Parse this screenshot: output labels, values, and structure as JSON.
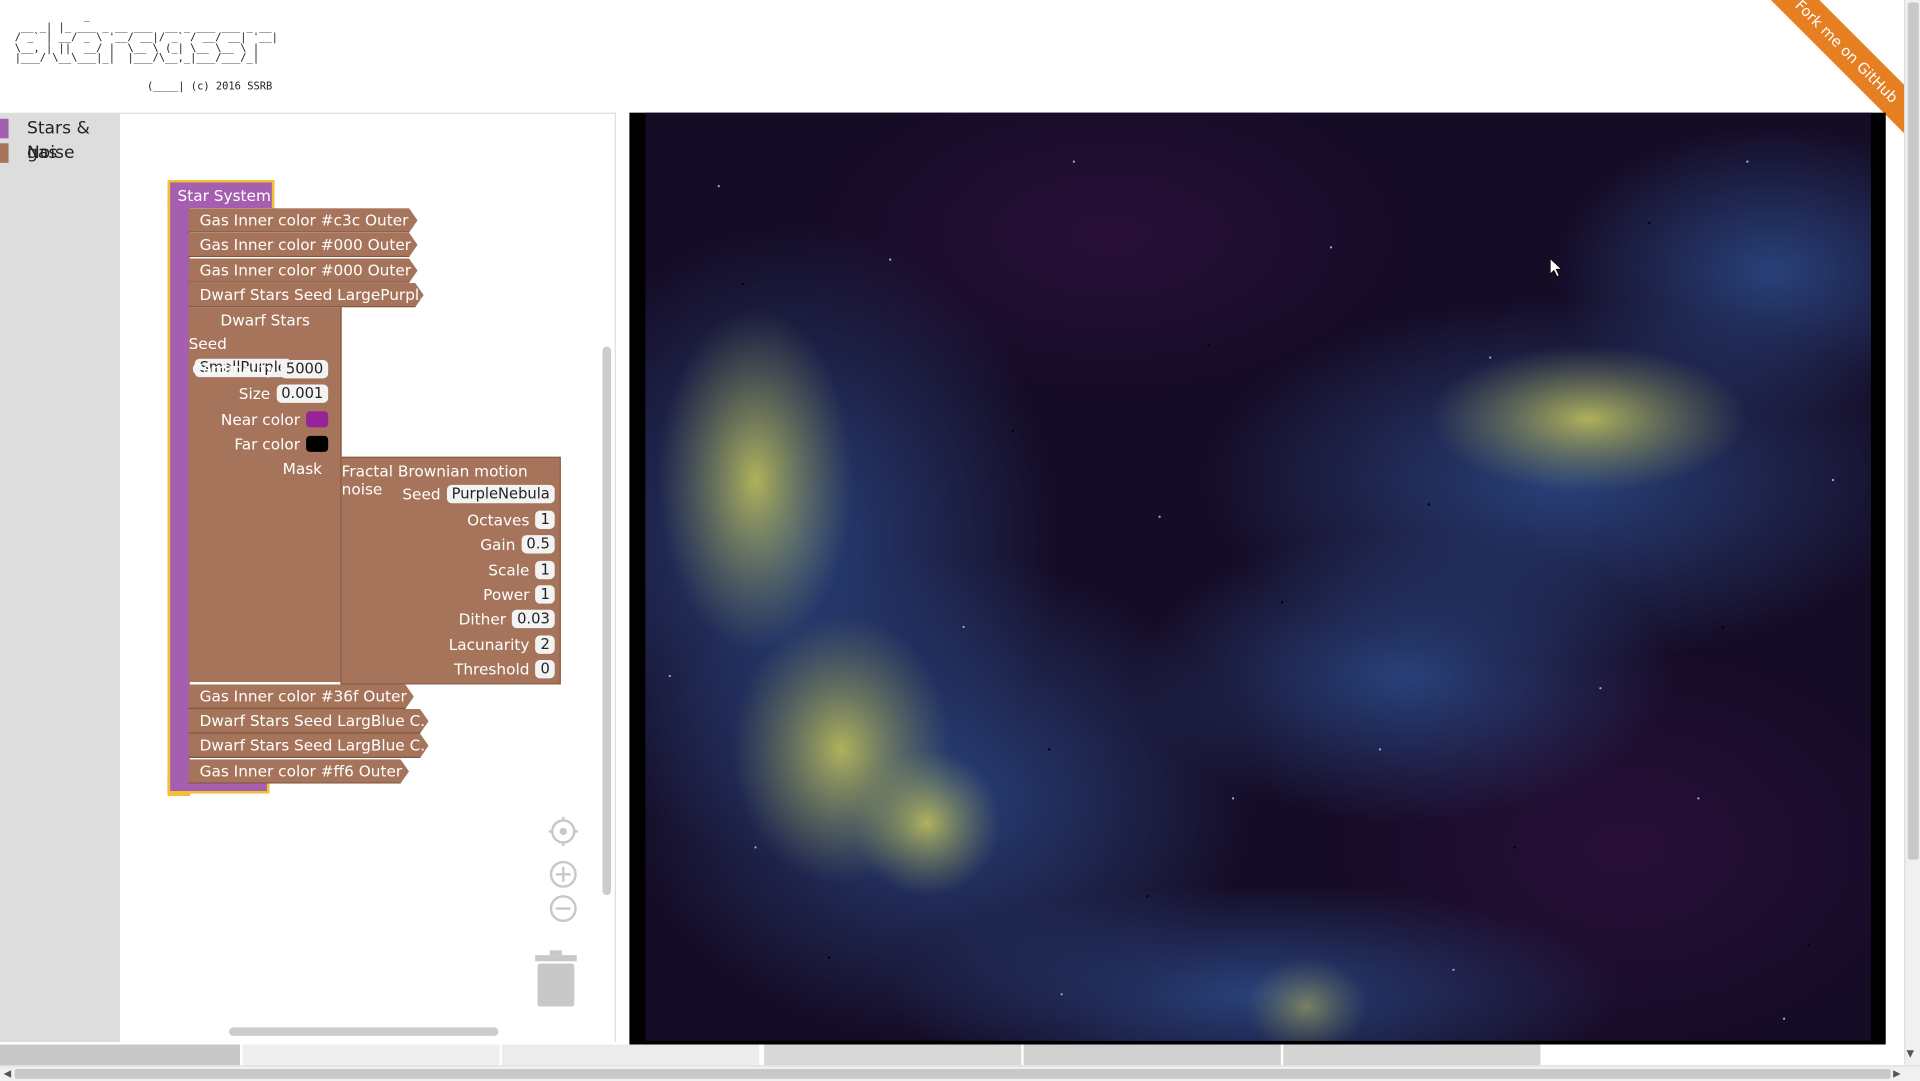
{
  "logo": {
    "ascii": "           _        \n __ _| |_ ___ _ __ ___  __ _ ___ ___ _ __ \n/ _` | __/ _ \\ '__/ __|/ _` / __/ __| '__|\n\\__, | ||  __/ |  \\__ \\ (_| \\__ \\__ \\ |   \n|___/ \\__\\___|_|  |___/\\__,_|___/___/_|   ",
    "copyright": "(____| (c) 2016 SSRB"
  },
  "ribbon": {
    "label": "Fork me on GitHub"
  },
  "toolbox": {
    "categories": [
      {
        "label": "Stars & gas",
        "color": "#a55eb0"
      },
      {
        "label": "Noise",
        "color": "#a5745a"
      }
    ]
  },
  "star_system": {
    "title": "Star System",
    "color": "#a55eb0",
    "outline": "#f2c231",
    "items_top": [
      "Gas Inner color #c3c Outer ...",
      "Gas Inner color #000 Outer ...",
      "Gas Inner color #000 Outer ...",
      "Dwarf Stars Seed LargePurpl..."
    ],
    "items_bottom": [
      "Gas Inner color #36f Outer ...",
      "Dwarf Stars Seed LargBlue C...",
      "Dwarf Stars Seed LargBlue C...",
      "Gas Inner color #ff6 Outer ..."
    ]
  },
  "dwarf_stars": {
    "title": "Dwarf Stars",
    "color": "#a5745a",
    "seed_label": "Seed",
    "seed": "SmallPurple",
    "cardinality_label": "Cardinality",
    "cardinality": "5000",
    "size_label": "Size",
    "size": "0.001",
    "near_label": "Near color",
    "near_color": "#992299",
    "far_label": "Far color",
    "far_color": "#000000",
    "mask_label": "Mask"
  },
  "fbm_noise": {
    "title": "Fractal Brownian motion noise",
    "seed_label": "Seed",
    "seed": "PurpleNebula",
    "octaves_label": "Octaves",
    "octaves": "1",
    "gain_label": "Gain",
    "gain": "0.5",
    "scale_label": "Scale",
    "scale": "1",
    "power_label": "Power",
    "power": "1",
    "dither_label": "Dither",
    "dither": "0.03",
    "lacunarity_label": "Lacunarity",
    "lacunarity": "2",
    "threshold_label": "Threshold",
    "threshold": "0"
  },
  "controls": {
    "recenter": "target-icon",
    "zoom_in": "plus-circle-icon",
    "zoom_out": "minus-circle-icon",
    "trash": "trash-icon"
  },
  "preview": {
    "colors": {
      "background": "#150c26",
      "nebula_blue": "#2c4a88",
      "nebula_yellow": "#c9c85a"
    }
  }
}
